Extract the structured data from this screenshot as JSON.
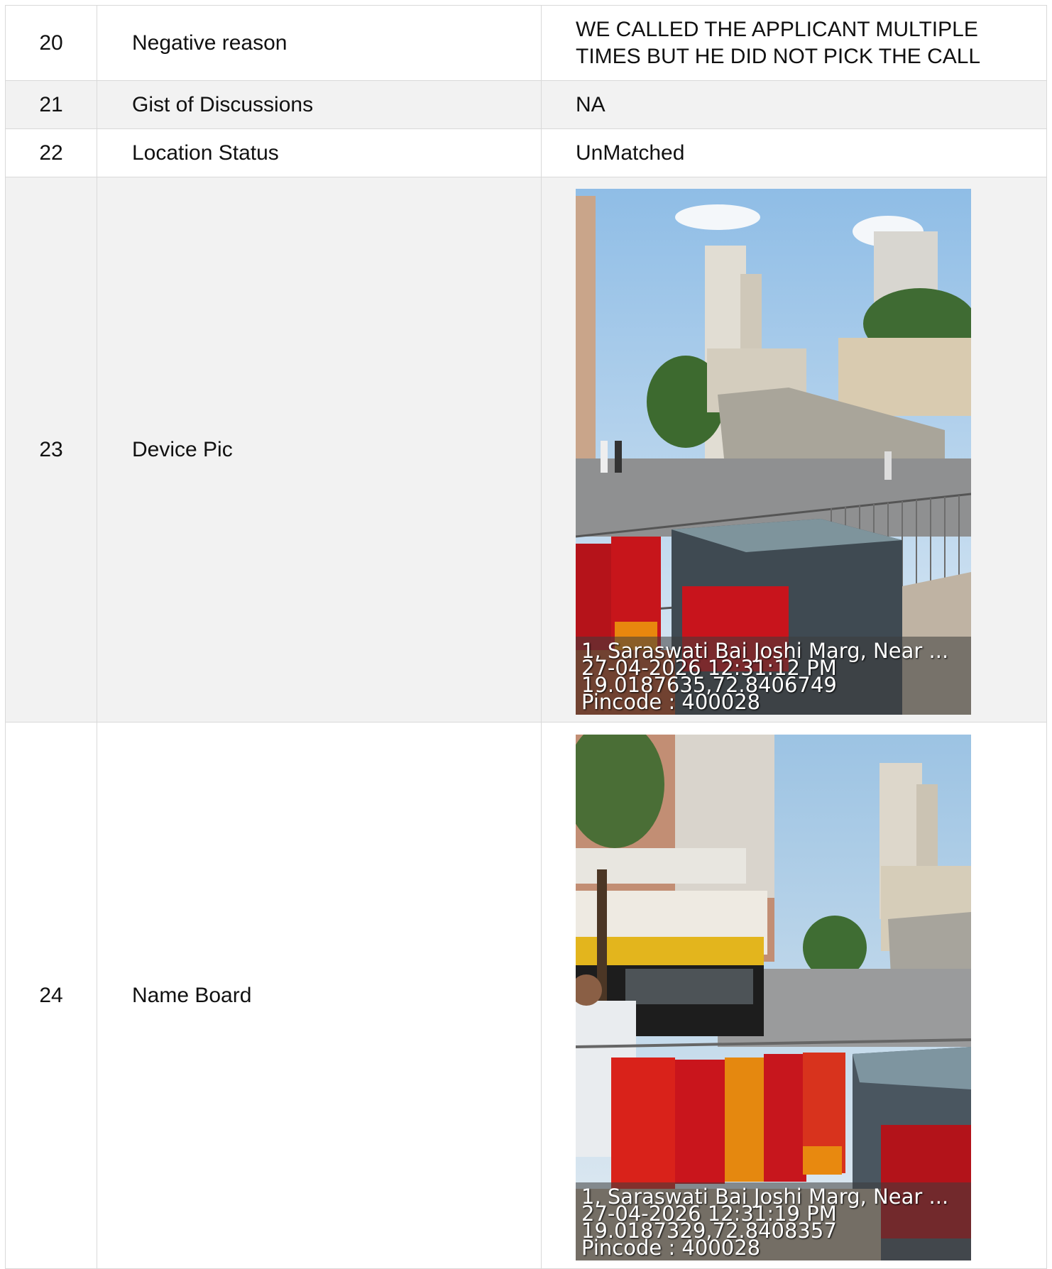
{
  "rows": [
    {
      "no": "20",
      "field": "Negative reason",
      "value": "WE CALLED THE APPLICANT MULTIPLE TIMES BUT HE DID NOT PICK THE CALL"
    },
    {
      "no": "21",
      "field": "Gist of Discussions",
      "value": "NA"
    },
    {
      "no": "22",
      "field": "Location Status",
      "value": "UnMatched"
    },
    {
      "no": "23",
      "field": "Device Pic",
      "photo": {
        "subject": "street scene with high-rise buildings, traffic roundabout and fenced utility box with red cloth banners",
        "stamp": [
          "1, Saraswati Bai Joshi Marg, Near ...",
          "27-04-2026 12:31:12 PM",
          "19.0187635,72.8406749",
          "Pincode : 400028"
        ]
      }
    },
    {
      "no": "24",
      "field": "Name Board",
      "photo": {
        "subject": "street with commercial building, yellow-black taxi, man standing near red and orange cloth banners on railing",
        "stamp": [
          "1, Saraswati Bai Joshi Marg, Near ...",
          "27-04-2026 12:31:19 PM",
          "19.0187329,72.8408357",
          "Pincode : 400028"
        ]
      }
    }
  ]
}
